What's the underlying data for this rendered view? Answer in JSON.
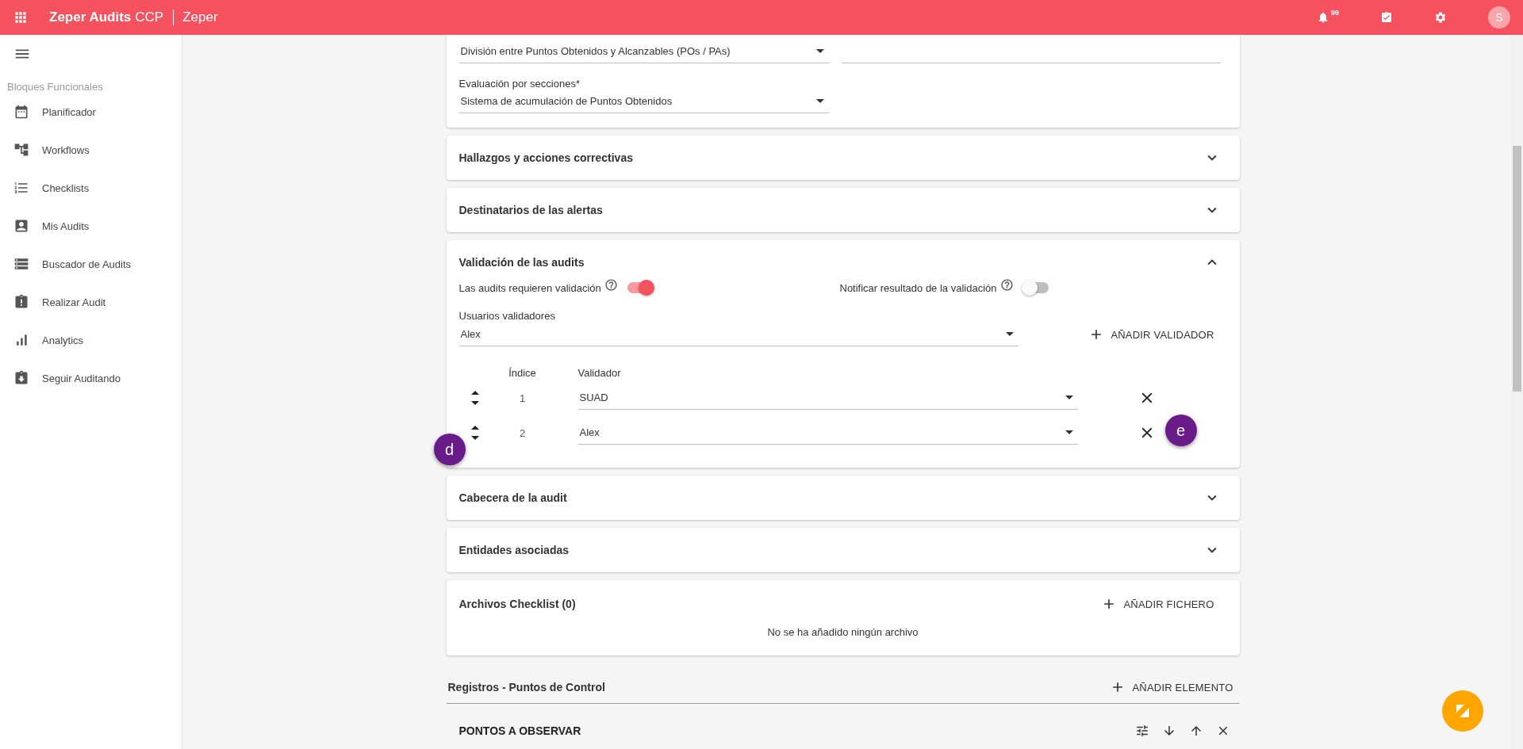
{
  "app_bar": {
    "title": "Zeper Audits",
    "title_suffix": "CCP",
    "organization": "Zeper",
    "notification_count": "99",
    "avatar": "S"
  },
  "sidebar": {
    "section_title": "Bloques Funcionales",
    "items": [
      {
        "label": "Planificador"
      },
      {
        "label": "Workflows"
      },
      {
        "label": "Checklists"
      },
      {
        "label": "Mis Audits"
      },
      {
        "label": "Buscador de Audits"
      },
      {
        "label": "Realizar Audit"
      },
      {
        "label": "Analytics"
      },
      {
        "label": "Seguir Auditando"
      }
    ]
  },
  "scoring_card": {
    "calculation_value": "División entre Puntos Obtenidos y Alcanzables (POs / PAs)",
    "section_label": "Evaluación por secciones*",
    "section_value": "Sistema de acumulación de Puntos Obtenidos"
  },
  "sections": [
    {
      "kind": "collapsed",
      "title": "Hallazgos y acciones correctivas",
      "expanded": false
    },
    {
      "kind": "collapsed",
      "title": "Destinatarios de las alertas",
      "expanded": false
    },
    {
      "kind": "validation",
      "title": "Validación de las audits",
      "expanded": true,
      "toggles": [
        {
          "label": "Las audits requieren validación",
          "on": true
        },
        {
          "label": "Notificar resultado de la validación",
          "on": false
        }
      ],
      "users_label": "Usuarios validadores",
      "user_select": "Alex",
      "add_button": "AÑADIR VALIDADOR",
      "columns": [
        "Índice",
        "Validador"
      ],
      "rows": [
        {
          "index": "1",
          "validator": "SUAD"
        },
        {
          "index": "2",
          "validator": "Alex"
        }
      ],
      "annotations": [
        {
          "label": "d"
        },
        {
          "label": "e"
        }
      ]
    },
    {
      "kind": "collapsed",
      "title": "Cabecera de la audit",
      "expanded": false
    },
    {
      "kind": "collapsed",
      "title": "Entidades asociadas",
      "expanded": false
    },
    {
      "kind": "files",
      "title": "Archivos Checklist (0)",
      "add_button": "AÑADIR FICHERO",
      "empty_message": "No se ha añadido ningún archivo"
    }
  ],
  "control_points": {
    "title": "Registros - Puntos de Control",
    "add_button": "AÑADIR ELEMENTO",
    "items": [
      {
        "title": "PONTOS A OBSERVAR"
      }
    ]
  }
}
